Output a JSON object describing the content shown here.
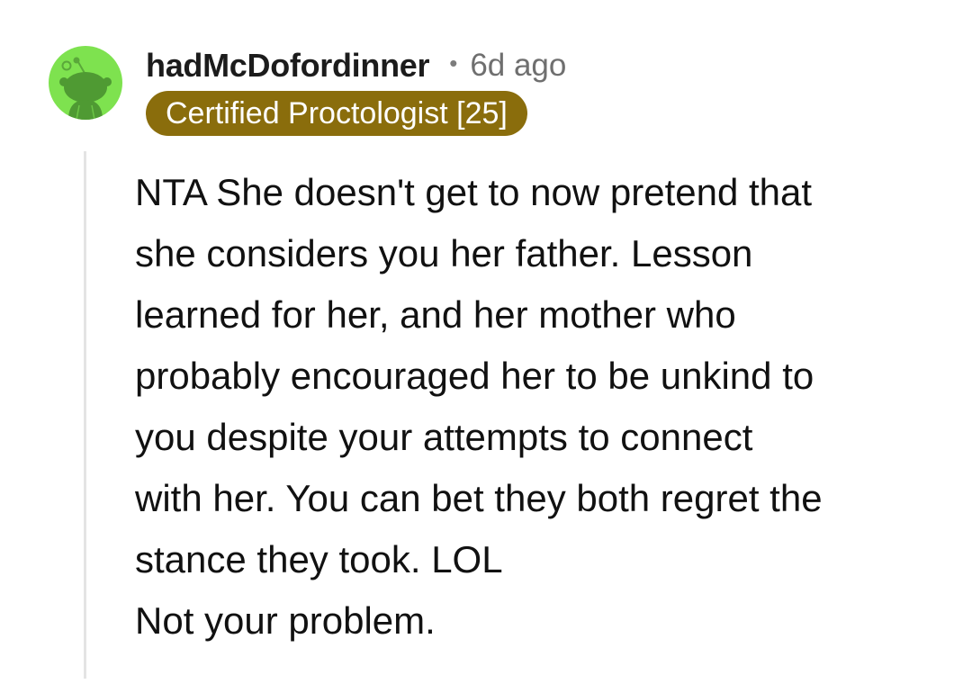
{
  "comment": {
    "username": "hadMcDofordinner",
    "separator": "•",
    "age": "6d ago",
    "flair": "Certified Proctologist [25]",
    "avatar_icon": "snoo-avatar-icon",
    "colors": {
      "avatar_bg": "#7ee24f",
      "flair_bg": "#8a6d0c",
      "flair_text": "#ffffff",
      "thread_line": "#e4e4e4"
    },
    "body_lines": [
      "NTA She doesn't get to now pretend that",
      "she considers you her father. Lesson",
      "learned for her, and her mother who",
      "probably encouraged her to be unkind to",
      "you despite your attempts to connect",
      "with her. You can bet they both regret the",
      "stance they took. LOL",
      "Not your problem."
    ]
  }
}
